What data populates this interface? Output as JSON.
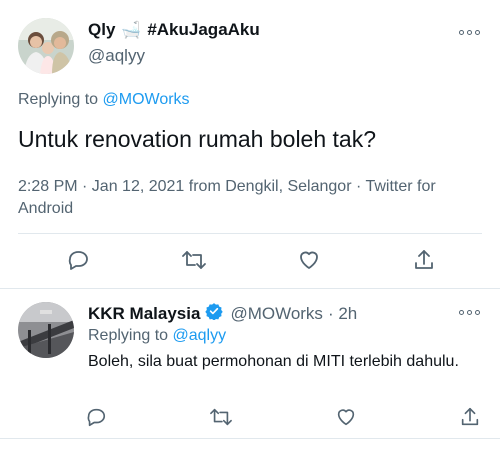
{
  "main_tweet": {
    "author": {
      "name": "Qly",
      "name_emoji": "🛁",
      "name_tag": "#AkuJagaAku",
      "handle": "@aqlyy"
    },
    "replying_prefix": "Replying to",
    "replying_handle": "@MOWorks",
    "text": "Untuk renovation rumah boleh tak?",
    "meta": "2:28 PM · Jan 12, 2021 from Dengkil, Selangor · Twitter for Android"
  },
  "reply_tweet": {
    "author": {
      "name": "KKR Malaysia",
      "verified": true,
      "handle": "@MOWorks",
      "time": "· 2h"
    },
    "replying_prefix": "Replying to",
    "replying_handle": "@aqlyy",
    "text": "Boleh, sila buat permohonan di MITI terlebih dahulu."
  },
  "icons": {
    "reply": "reply-icon",
    "retweet": "retweet-icon",
    "like": "heart-icon",
    "share": "share-icon",
    "more": "more-options-icon",
    "verified": "verified-badge-icon"
  },
  "colors": {
    "accent": "#1d9bf0",
    "secondary_text": "#536471",
    "primary_text": "#0f1419",
    "divider": "#e1e8ed"
  }
}
